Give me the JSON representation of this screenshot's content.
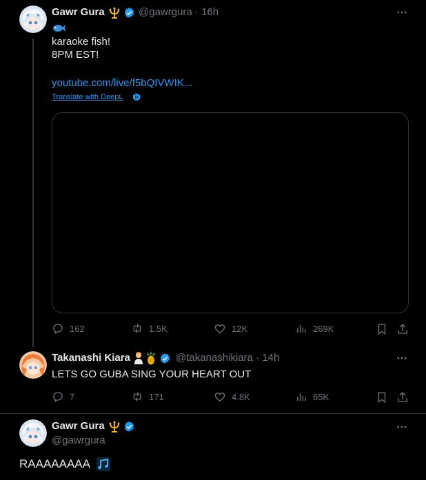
{
  "colors": {
    "background": "#000000",
    "text": "#e7e9ea",
    "muted": "#71767b",
    "link": "#1d9bf0",
    "verified": "#1d9bf0",
    "thread_line": "#333639",
    "border": "#2f3336"
  },
  "tweet1": {
    "author": "Gawr Gura",
    "handle_time": "@gawrgura · 16h",
    "line1_icon": "fish-emoji",
    "line2": "karaoke fish!",
    "line3": "8PM EST!",
    "link": "youtube.com/live/f5bQIVWIK...",
    "translate": "Translate with DeepL",
    "stats": {
      "replies": "162",
      "retweets": "1.5K",
      "likes": "12K",
      "views": "269K"
    }
  },
  "tweet2": {
    "author": "Takanashi Kiara",
    "handle_time": "@takanashikiara · 14h",
    "text": "LETS GO GUBA SING YOUR HEART OUT",
    "stats": {
      "replies": "7",
      "retweets": "171",
      "likes": "4.8K",
      "views": "65K"
    }
  },
  "main": {
    "author": "Gawr Gura",
    "handle": "@gawrgura",
    "text": "RAAAAAAAA",
    "emoji_icon": "music-notes-emoji"
  }
}
